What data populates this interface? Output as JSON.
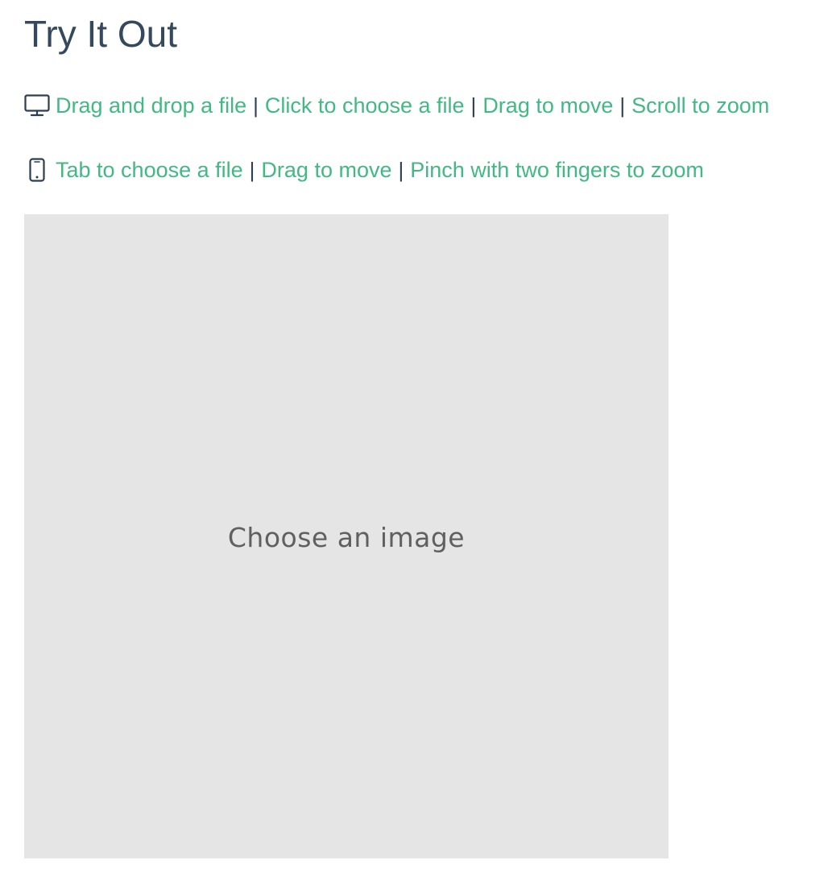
{
  "page": {
    "title": "Try It Out"
  },
  "desktop_hints": {
    "icon": "desktop-monitor-icon",
    "items": [
      "Drag and drop a file",
      "Click to choose a file",
      "Drag to move",
      "Scroll to zoom"
    ],
    "separator": "|"
  },
  "mobile_hints": {
    "icon": "mobile-phone-icon",
    "items": [
      "Tab to choose a file",
      "Drag to move",
      "Pinch with two fingers to zoom"
    ],
    "separator": "|"
  },
  "cropper": {
    "placeholder": "Choose an image"
  },
  "colors": {
    "link": "#42b983",
    "title": "#34495e",
    "text": "#2c3e50",
    "canvas_bg": "#e5e5e5",
    "placeholder": "#606060"
  }
}
